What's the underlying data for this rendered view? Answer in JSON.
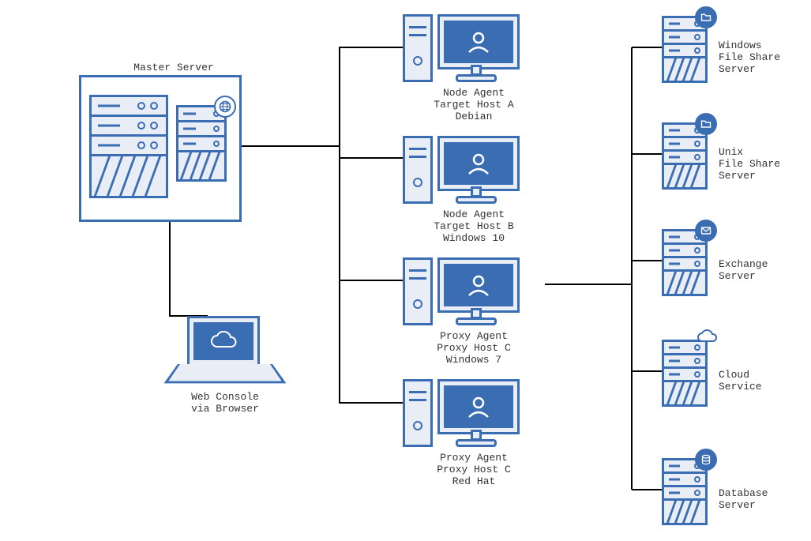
{
  "colors": {
    "primary": "#3b6db3",
    "panel_fill": "#e9eef6",
    "line": "#000000"
  },
  "master": {
    "title": "Master Server",
    "badge_icon": "globe-icon"
  },
  "web_console": {
    "line1": "Web Console",
    "line2": "via Browser",
    "badge_icon": "cloud-icon"
  },
  "agents": [
    {
      "id": "agent-a",
      "line1": "Node Agent",
      "line2": "Target Host A",
      "line3": "Debian"
    },
    {
      "id": "agent-b",
      "line1": "Node Agent",
      "line2": "Target Host B",
      "line3": "Windows 10"
    },
    {
      "id": "agent-c",
      "line1": "Proxy Agent",
      "line2": "Proxy Host C",
      "line3": "Windows 7"
    },
    {
      "id": "agent-d",
      "line1": "Proxy Agent",
      "line2": "Proxy Host C",
      "line3": "Red Hat"
    }
  ],
  "targets": [
    {
      "id": "windows-fs",
      "line1": "Windows",
      "line2": "File Share",
      "line3": "Server",
      "badge_icon": "folder-icon"
    },
    {
      "id": "unix-fs",
      "line1": "Unix",
      "line2": "File Share",
      "line3": "Server",
      "badge_icon": "folder-icon"
    },
    {
      "id": "exchange",
      "line1": "Exchange",
      "line2": "Server",
      "line3": "",
      "badge_icon": "mail-icon"
    },
    {
      "id": "cloud",
      "line1": "Cloud",
      "line2": "Service",
      "line3": "",
      "badge_icon": "cloud-icon"
    },
    {
      "id": "database",
      "line1": "Database",
      "line2": "Server",
      "line3": "",
      "badge_icon": "database-icon"
    }
  ]
}
